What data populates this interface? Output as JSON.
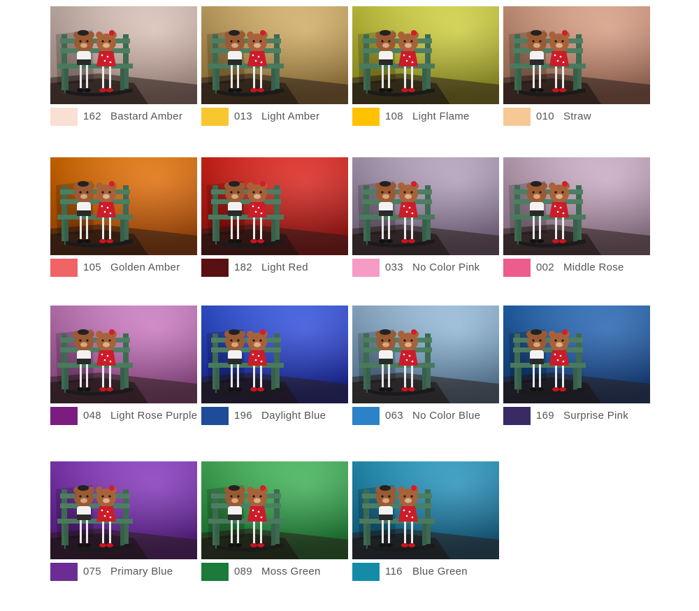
{
  "filters": [
    {
      "code": "162",
      "name": "Bastard Amber",
      "swatch": "#f9e0d4",
      "bg_top": "#efd8ce",
      "bg_bottom": "#b89a90",
      "wall": "#ead3c7"
    },
    {
      "code": "013",
      "name": "Light Amber",
      "swatch": "#f8c62f",
      "bg_top": "#f0c87a",
      "bg_bottom": "#a07c38",
      "wall": "#e6bc6a"
    },
    {
      "code": "108",
      "name": "Light Flame",
      "swatch": "#ffc200",
      "bg_top": "#eeee4a",
      "bg_bottom": "#9a9a22",
      "wall": "#e2e040"
    },
    {
      "code": "010",
      "name": "Straw",
      "swatch": "#f6c896",
      "bg_top": "#f6b696",
      "bg_bottom": "#a8705a",
      "wall": "#eeaa88"
    },
    {
      "code": "105",
      "name": "Golden Amber",
      "swatch": "#ef6464",
      "bg_top": "#ff8000",
      "bg_bottom": "#b04800",
      "wall": "#f87000"
    },
    {
      "code": "182",
      "name": "Light Red",
      "swatch": "#5a1012",
      "bg_top": "#ff2a1e",
      "bg_bottom": "#a00e0c",
      "wall": "#f01c14"
    },
    {
      "code": "033",
      "name": "No Color Pink",
      "swatch": "#f59bc4",
      "bg_top": "#cebbd8",
      "bg_bottom": "#7e6c88",
      "wall": "#c0aece"
    },
    {
      "code": "002",
      "name": "Middle Rose",
      "swatch": "#ec5c8c",
      "bg_top": "#e6c6e0",
      "bg_bottom": "#9a7c94",
      "wall": "#dcb6d4"
    },
    {
      "code": "048",
      "name": "Light Rose Purple",
      "swatch": "#7a1c80",
      "bg_top": "#e890dc",
      "bg_bottom": "#9a4c90",
      "wall": "#dc7ed2"
    },
    {
      "code": "196",
      "name": "Daylight Blue",
      "swatch": "#1e4c9a",
      "bg_top": "#3c64ff",
      "bg_bottom": "#1222a0",
      "wall": "#2c50ee"
    },
    {
      "code": "063",
      "name": "No Color Blue",
      "swatch": "#2c82c8",
      "bg_top": "#b0d6f6",
      "bg_bottom": "#5c84a6",
      "wall": "#9ac8ee"
    },
    {
      "code": "169",
      "name": "Surprise Pink",
      "swatch": "#3a2a64",
      "bg_top": "#2a78d0",
      "bg_bottom": "#0e3c80",
      "wall": "#1e66bc"
    },
    {
      "code": "075",
      "name": "Primary Blue",
      "swatch": "#6c2c96",
      "bg_top": "#9c44d8",
      "bg_bottom": "#58188c",
      "wall": "#8c34cc"
    },
    {
      "code": "089",
      "name": "Moss Green",
      "swatch": "#1c7a3a",
      "bg_top": "#50d068",
      "bg_bottom": "#167a2e",
      "wall": "#3cbc56"
    },
    {
      "code": "116",
      "name": "Blue Green",
      "swatch": "#148ca8",
      "bg_top": "#2cb0dc",
      "bg_bottom": "#0c5c84",
      "wall": "#1e9ccc"
    }
  ]
}
